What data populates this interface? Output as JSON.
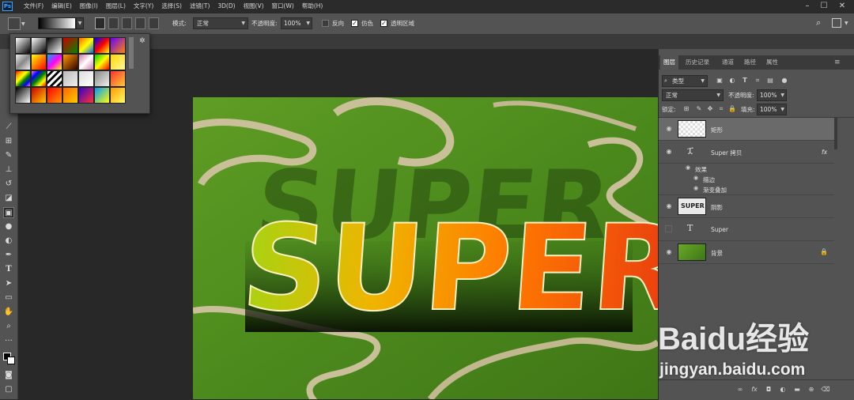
{
  "app": {
    "logo": "Ps"
  },
  "menu": [
    "文件(F)",
    "编辑(E)",
    "图像(I)",
    "图层(L)",
    "文字(Y)",
    "选择(S)",
    "滤镜(T)",
    "3D(D)",
    "视图(V)",
    "窗口(W)",
    "帮助(H)"
  ],
  "options": {
    "mode_label": "模式:",
    "mode_value": "正常",
    "opacity_label": "不透明度:",
    "opacity_value": "100%",
    "reverse_label": "反向",
    "reverse_checked": false,
    "dither_label": "仿色",
    "dither_checked": true,
    "transparency_label": "透明区域",
    "transparency_checked": true
  },
  "canvas": {
    "text": "SUPER"
  },
  "panel": {
    "tabs": [
      "图层",
      "历史记录",
      "通道",
      "路径",
      "属性"
    ],
    "filter_kind": "类型",
    "blend_mode": "正常",
    "opacity_label": "不透明度:",
    "opacity_value": "100%",
    "lock_label": "锁定:",
    "fill_label": "填充:",
    "fill_value": "100%",
    "layers": [
      {
        "name": "矩形",
        "visible": true,
        "selected": true
      },
      {
        "name": "Super 拷贝",
        "visible": true,
        "fx": "fx"
      },
      {
        "name": "效果",
        "visible": true
      },
      {
        "name": "描边",
        "visible": true
      },
      {
        "name": "渐变叠加",
        "visible": true
      },
      {
        "name": "阴影",
        "visible": true,
        "thumb_text": "SUPER"
      },
      {
        "name": "Super",
        "visible": false
      },
      {
        "name": "背景",
        "visible": true,
        "locked": true
      }
    ]
  },
  "watermark": {
    "brand": "Baidu经验",
    "url": "jingyan.baidu.com"
  },
  "colors": {
    "accent": "#31a8ff",
    "panel": "#535353",
    "menubar": "#2b2b2b"
  }
}
